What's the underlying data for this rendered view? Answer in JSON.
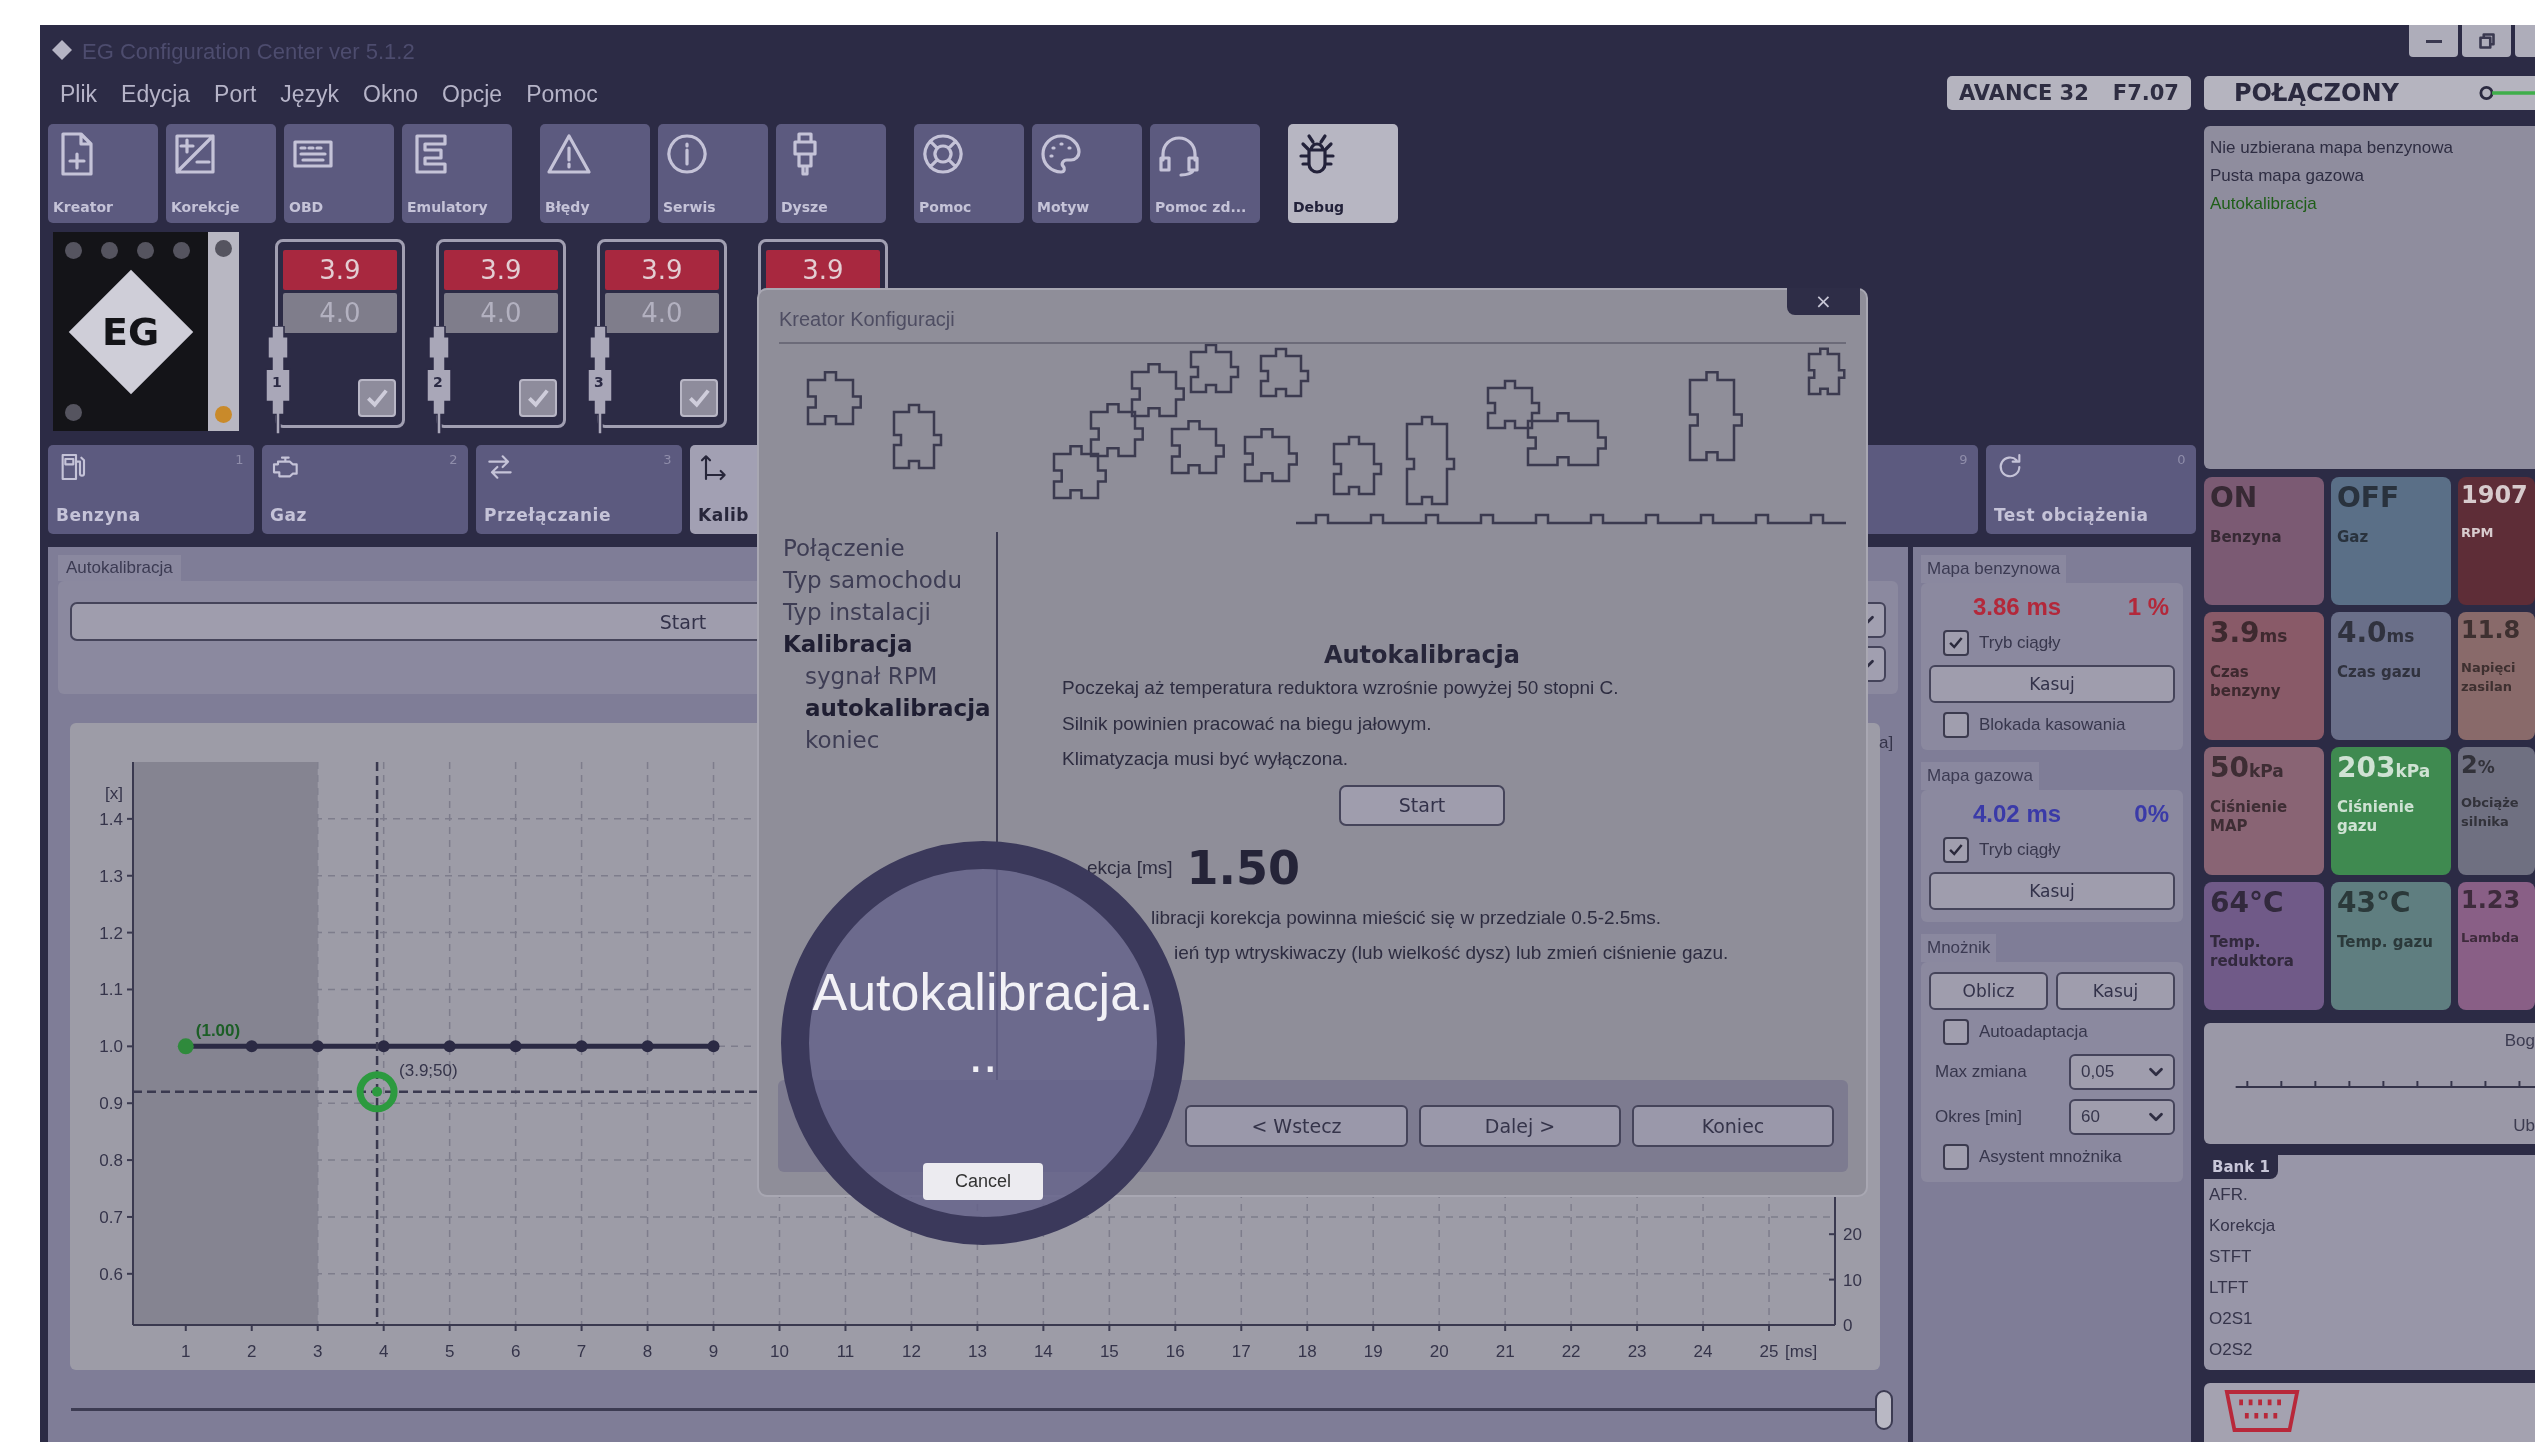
{
  "window": {
    "title": "EG Configuration Center ver 5.1.2"
  },
  "menu": [
    "Plik",
    "Edycja",
    "Port",
    "Język",
    "Okno",
    "Opcje",
    "Pomoc"
  ],
  "device": {
    "model": "AVANCE 32",
    "firmware": "F7.07"
  },
  "connection": {
    "status": "POŁĄCZONY",
    "connected": true
  },
  "toolbar": [
    [
      {
        "label": "Kreator",
        "kind": "document",
        "selected": false
      },
      {
        "label": "Korekcje",
        "kind": "plusminus",
        "selected": false
      },
      {
        "label": "OBD",
        "kind": "keyboard",
        "selected": false
      },
      {
        "label": "Emulatory",
        "kind": "eshape",
        "selected": false
      }
    ],
    [
      {
        "label": "Błędy",
        "kind": "warning",
        "selected": false
      },
      {
        "label": "Serwis",
        "kind": "info",
        "selected": false
      },
      {
        "label": "Dysze",
        "kind": "injector",
        "selected": false
      }
    ],
    [
      {
        "label": "Pomoc",
        "kind": "lifebuoy",
        "selected": false
      },
      {
        "label": "Motyw",
        "kind": "palette",
        "selected": false
      },
      {
        "label": "Pomoc zd...",
        "kind": "headset",
        "selected": false
      }
    ],
    [
      {
        "label": "Debug",
        "kind": "bug",
        "selected": true
      }
    ]
  ],
  "logo": "EG",
  "injectors": [
    {
      "number": "1",
      "petrol": "3.9",
      "gas": "4.0",
      "checked": true
    },
    {
      "number": "2",
      "petrol": "3.9",
      "gas": "4.0",
      "checked": true
    },
    {
      "number": "3",
      "petrol": "3.9",
      "gas": "4.0",
      "checked": true
    },
    {
      "petrol": "3.9"
    }
  ],
  "tabs": [
    {
      "label": "Benzyna",
      "count": "1",
      "kind": "fuel",
      "selected": false
    },
    {
      "label": "Gaz",
      "count": "2",
      "kind": "engine",
      "selected": false
    },
    {
      "label": "Przełączanie",
      "count": "3",
      "kind": "arrows",
      "selected": false
    },
    {
      "label": "Kalib",
      "kind": "axis",
      "selected": true
    },
    {
      "count": "9",
      "selected": false
    },
    {
      "label": "Test obciążenia",
      "count": "0",
      "kind": "refresh",
      "selected": false
    }
  ],
  "autocal": {
    "group": "Autokalibracja",
    "start": "Start",
    "chart_data": {
      "type": "line",
      "xlabel": "[ms]",
      "ylabel": "[x]",
      "y2label": "a]",
      "xlim": [
        0.2,
        26
      ],
      "ylim": [
        0.51,
        1.5
      ],
      "y2lim": [
        0,
        124
      ],
      "grid": true,
      "marker": "circle",
      "xticks": [
        1,
        2,
        3,
        4,
        5,
        6,
        7,
        8,
        9,
        10,
        11,
        12,
        13,
        14,
        15,
        16,
        17,
        18,
        19,
        20,
        21,
        22,
        23,
        24,
        25
      ],
      "yticks": [
        {
          "value": 0.6,
          "label": "0.6"
        },
        {
          "value": 0.7,
          "label": "0.7"
        },
        {
          "value": 0.8,
          "label": "0.8"
        },
        {
          "value": 0.9,
          "label": "0.9"
        },
        {
          "value": 1,
          "label": "1.0"
        },
        {
          "value": 1.1,
          "label": "1.1"
        },
        {
          "value": 1.2,
          "label": "1.2"
        },
        {
          "value": 1.3,
          "label": "1.3"
        },
        {
          "value": 1.4,
          "label": "1.4"
        }
      ],
      "y2ticks": [
        0,
        10,
        20
      ],
      "x": [
        1,
        2,
        3,
        4,
        5,
        6,
        7,
        8,
        9
      ],
      "values": [
        1,
        1,
        1,
        1,
        1,
        1,
        1,
        1,
        1
      ],
      "bands": [
        {
          "axis": "x",
          "from": 0.2,
          "to": 3
        }
      ],
      "ref_lines": [
        {
          "axis": "x",
          "value": 3.9
        },
        {
          "axis": "y",
          "value": 0.92
        }
      ],
      "annotations": [
        {
          "text": "(1.00)",
          "x": 1,
          "y": 1
        },
        {
          "text": "(3.9;50)",
          "x": 3.9,
          "y": 0.92
        }
      ]
    },
    "slider": {
      "level": 1
    }
  },
  "petrol_map": {
    "title": "Mapa benzynowa",
    "time": "3.86 ms",
    "percent": "1 %",
    "continuous": {
      "label": "Tryb ciągły",
      "checked": true
    },
    "clear": "Kasuj",
    "lock": {
      "label": "Blokada kasowania",
      "checked": false
    }
  },
  "gas_map": {
    "title": "Mapa gazowa",
    "time": "4.02 ms",
    "percent": "0%",
    "continuous": {
      "label": "Tryb ciągły",
      "checked": true
    },
    "clear": "Kasuj"
  },
  "multiplier": {
    "title": "Mnożnik",
    "compute": "Oblicz",
    "clear": "Kasuj",
    "autoadapt": {
      "label": "Autoadaptacja",
      "checked": false
    },
    "max_change": {
      "label": "Max zmiana",
      "value": "0,05"
    },
    "period": {
      "label": "Okres [min]",
      "value": "60"
    },
    "assistant": {
      "label": "Asystent mnożnika",
      "checked": false
    }
  },
  "messages": [
    {
      "text": "Nie uzbierana mapa benzynowa",
      "kind": "info"
    },
    {
      "text": "Pusta mapa gazowa",
      "kind": "info"
    },
    {
      "text": "Autokalibracja",
      "kind": "active"
    }
  ],
  "tiles": [
    {
      "value": "ON",
      "label": "Benzyna",
      "color": "#7b5a73",
      "kind": "normal"
    },
    {
      "value": "OFF",
      "label": "Gaz",
      "color": "#5a6f87",
      "kind": "normal"
    },
    {
      "value": "1907",
      "label": "RPM",
      "color": "#5e2d37",
      "kind": "inverse"
    },
    {
      "value": "3.9",
      "unit": "ms",
      "label": "Czas benzyny",
      "color": "#895a68",
      "kind": "normal"
    },
    {
      "value": "4.0",
      "unit": "ms",
      "label": "Czas gazu",
      "color": "#6a6f89",
      "kind": "normal"
    },
    {
      "value": "11.8",
      "label": "Napięci zasilan",
      "color": "#896a6a",
      "kind": "normal"
    },
    {
      "value": "50",
      "unit": "kPa",
      "label": "Ciśnienie MAP",
      "color": "#896474",
      "kind": "normal"
    },
    {
      "value": "203",
      "unit": "kPa",
      "label": "Ciśnienie gazu",
      "color": "#3f8a50",
      "kind": "inverse"
    },
    {
      "value": "2",
      "unit": "%",
      "label": "Obciąże silnika",
      "color": "#6f7081",
      "kind": "normal"
    },
    {
      "value": "64°C",
      "label": "Temp. reduktora",
      "color": "#705a88",
      "kind": "normal"
    },
    {
      "value": "43°C",
      "label": "Temp. gazu",
      "color": "#5f7e80",
      "kind": "normal"
    },
    {
      "value": "1.23",
      "label": "Lambda",
      "color": "#895f86",
      "kind": "normal"
    }
  ],
  "mixture_gauge": {
    "top_label": "Bog",
    "bottom_label": "Ub"
  },
  "bank": {
    "title": "Bank 1",
    "rows": [
      "AFR.",
      "Korekcja",
      "STFT",
      "LTFT",
      "O2S1",
      "O2S2"
    ]
  },
  "dialog": {
    "title": "Kreator Konfiguracji",
    "close": "×",
    "steps": [
      {
        "label": "Połączenie",
        "active": false
      },
      {
        "label": "Typ samochodu",
        "active": false
      },
      {
        "label": "Typ instalacji",
        "active": false
      },
      {
        "label": "Kalibracja",
        "active": true,
        "children": [
          {
            "label": "sygnał RPM",
            "active": false
          },
          {
            "label": "autokalibracja",
            "active": true
          },
          {
            "label": "koniec",
            "active": false
          }
        ]
      }
    ],
    "heading": "Autokalibracja",
    "instructions": [
      "Poczekaj aż temperatura reduktora wzrośnie powyżej 50 stopni C.",
      "Silnik powinien pracować na biegu jałowym.",
      "Klimatyzacja musi być wyłączona."
    ],
    "start": "Start",
    "correction": {
      "label": "ekcja [ms]",
      "value": "1.50"
    },
    "notes": [
      "libracji korekcja powinna mieścić się w przedziale 0.5-2.5ms.",
      "ień typ wtryskiwaczy (lub wielkość dysz) lub zmień ciśnienie gazu."
    ],
    "buttons": [
      "< Wstecz",
      "Dalej >",
      "Koniec"
    ]
  },
  "busy": {
    "text": "Autokalibracja...",
    "cancel": "Cancel"
  }
}
